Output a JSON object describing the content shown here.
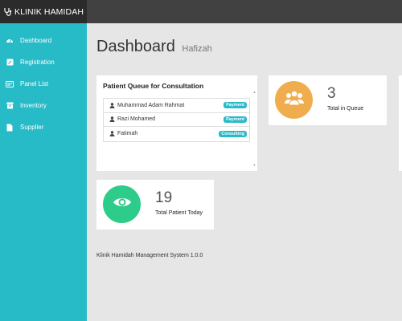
{
  "brand": {
    "title": "KLINIK HAMIDAH",
    "icon": "stethoscope-icon"
  },
  "sidebar": {
    "items": [
      {
        "label": "Dashboard",
        "icon": "dashboard-icon"
      },
      {
        "label": "Registration",
        "icon": "edit-icon"
      },
      {
        "label": "Panel List",
        "icon": "card-icon"
      },
      {
        "label": "Inventory",
        "icon": "box-icon"
      },
      {
        "label": "Supplier",
        "icon": "file-icon"
      }
    ]
  },
  "page": {
    "title": "Dashboard",
    "subtitle": "Hafizah"
  },
  "queue": {
    "title": "Patient Queue for Consultation",
    "patients": [
      {
        "name": "Muhammad Adam Rahmat",
        "status": "Payment"
      },
      {
        "name": "Razi Mohamed",
        "status": "Payment"
      },
      {
        "name": "Fatimah",
        "status": "Consulting"
      }
    ]
  },
  "stats": {
    "in_queue": {
      "value": "3",
      "label": "Total in Queue",
      "color": "#f0ad4e",
      "icon": "users-icon"
    },
    "today": {
      "value": "19",
      "label": "Total Patient Today",
      "color": "#2ecc8a",
      "icon": "eye-icon"
    }
  },
  "footer": {
    "text": "Klinik Hamidah Management System 1.0.0"
  },
  "colors": {
    "sidebar": "#27bac7",
    "topbar": "#414141",
    "badge": "#27bac7"
  }
}
